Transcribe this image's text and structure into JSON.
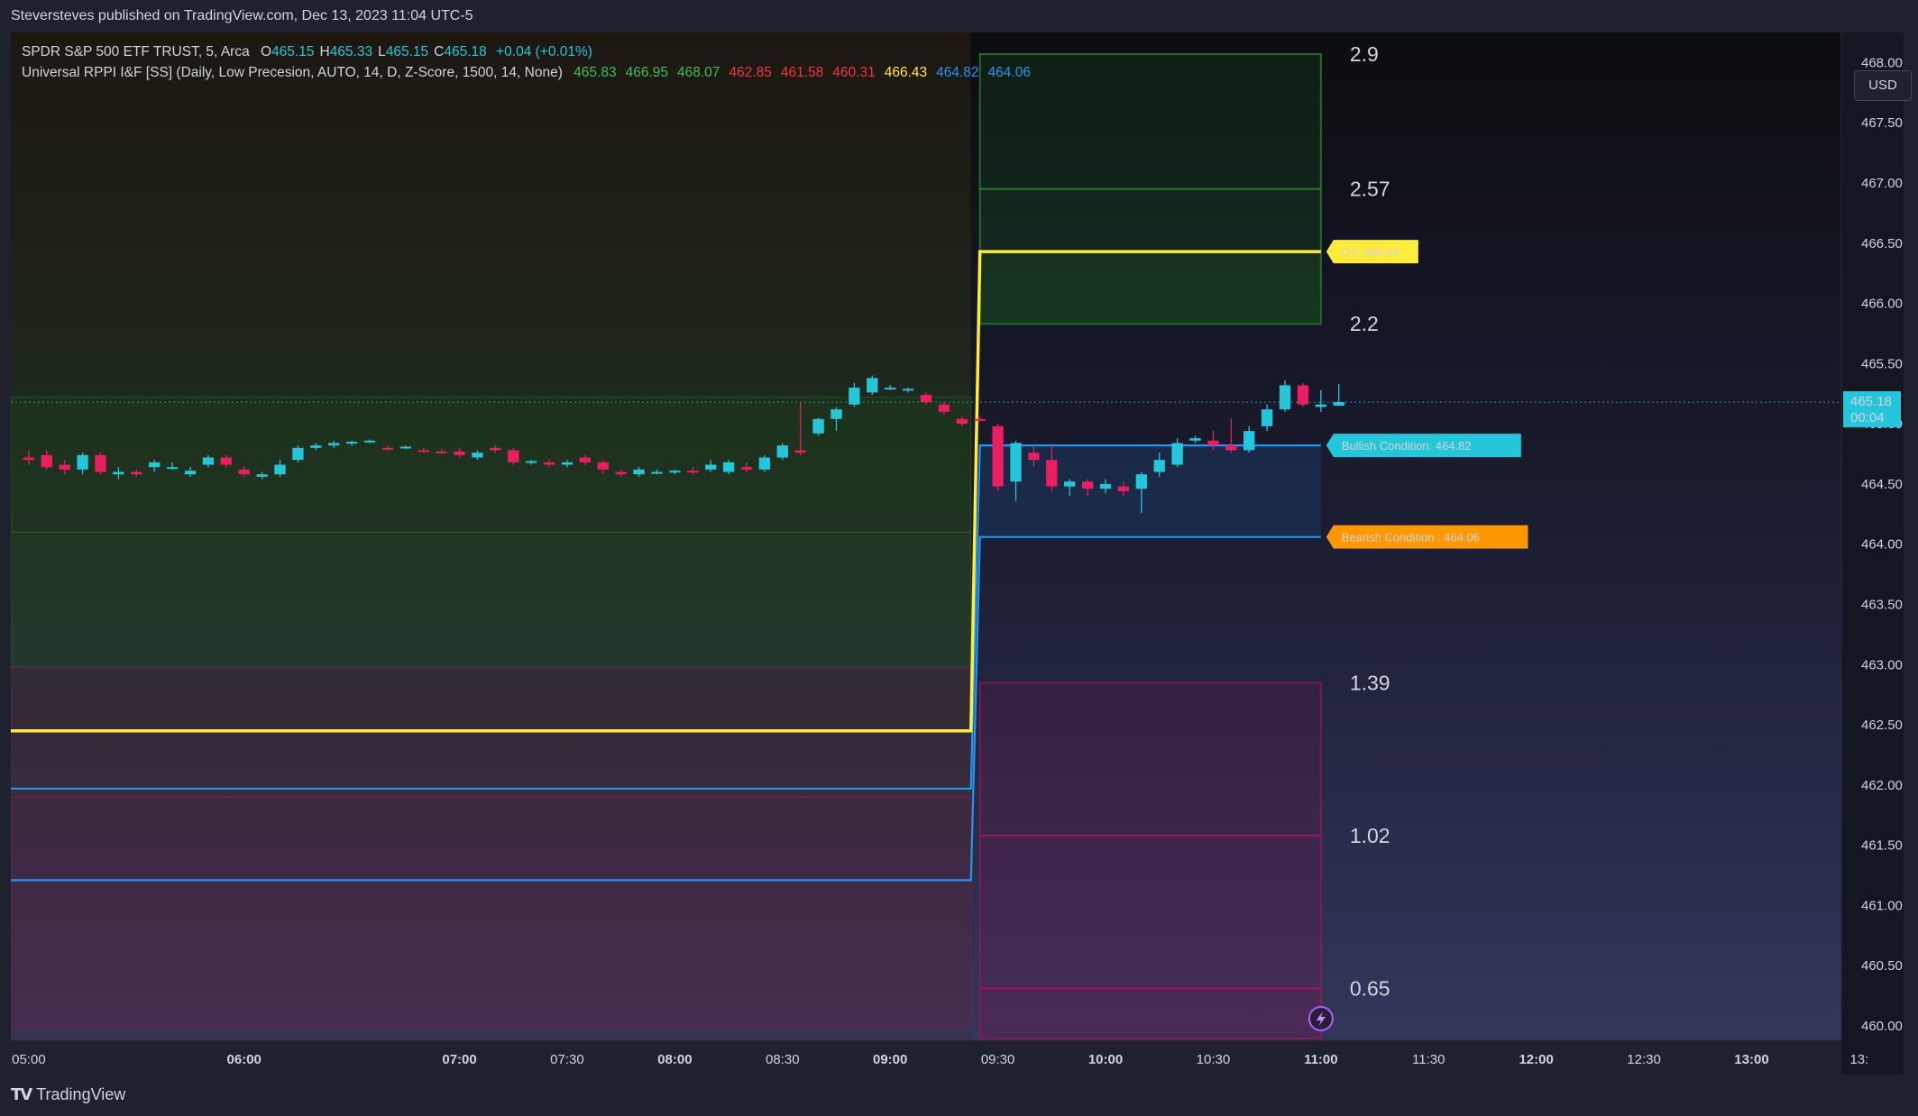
{
  "publish": {
    "text": "Steversteves published on TradingView.com, Dec 13, 2023 11:04 UTC-5"
  },
  "currency": "USD",
  "footer": {
    "brand": "TradingView"
  },
  "legend": {
    "symbol": "SPDR S&P 500 ETF TRUST, 5, Arca",
    "ohlc": [
      {
        "key": "O",
        "value": "465.15"
      },
      {
        "key": "H",
        "value": "465.33"
      },
      {
        "key": "L",
        "value": "465.15"
      },
      {
        "key": "C",
        "value": "465.18"
      }
    ],
    "change": "+0.04 (+0.01%)",
    "indicator": "Universal RPPI I&F [SS] (Daily, Low Precesion, AUTO, 14, D, Z-Score, 1500, 14, None)",
    "indicator_values": [
      {
        "text": "465.83",
        "color": "#3fbf5a"
      },
      {
        "text": "466.95",
        "color": "#3fbf5a"
      },
      {
        "text": "468.07",
        "color": "#3fbf5a"
      },
      {
        "text": "462.85",
        "color": "#f23645"
      },
      {
        "text": "461.58",
        "color": "#f23645"
      },
      {
        "text": "460.31",
        "color": "#f23645"
      },
      {
        "text": "466.43",
        "color": "#ffeb3b"
      },
      {
        "text": "464.82",
        "color": "#2196f3"
      },
      {
        "text": "464.06",
        "color": "#2196f3"
      }
    ]
  },
  "colors": {
    "up": "#26c6da",
    "down": "#e91e63",
    "gt": "#ffeb3b",
    "condition": "#2196f3",
    "bull_label": "#26c6da",
    "bear_label": "#ff9800",
    "zone_green": "#1b5e20",
    "zone_red": "#880e4f"
  },
  "chart_data": {
    "type": "candlestick",
    "title": "",
    "xlabel": "",
    "ylabel": "",
    "ylim": [
      459.88,
      468.25
    ],
    "xlim_minutes": [
      295,
      805
    ],
    "y_ticks": [
      "460.00",
      "460.50",
      "461.00",
      "461.50",
      "462.00",
      "462.50",
      "463.00",
      "463.50",
      "464.00",
      "464.50",
      "465.00",
      "465.50",
      "466.00",
      "466.50",
      "467.00",
      "467.50",
      "468.00"
    ],
    "x_ticks": [
      {
        "label": "05:00",
        "minute": 300,
        "bold": false
      },
      {
        "label": "06:00",
        "minute": 360,
        "bold": true
      },
      {
        "label": "07:00",
        "minute": 420,
        "bold": true
      },
      {
        "label": "07:30",
        "minute": 450,
        "bold": false
      },
      {
        "label": "08:00",
        "minute": 480,
        "bold": true
      },
      {
        "label": "08:30",
        "minute": 510,
        "bold": false
      },
      {
        "label": "09:00",
        "minute": 540,
        "bold": true
      },
      {
        "label": "09:30",
        "minute": 570,
        "bold": false
      },
      {
        "label": "10:00",
        "minute": 600,
        "bold": true
      },
      {
        "label": "10:30",
        "minute": 630,
        "bold": false
      },
      {
        "label": "11:00",
        "minute": 660,
        "bold": true
      },
      {
        "label": "11:30",
        "minute": 690,
        "bold": false
      },
      {
        "label": "12:00",
        "minute": 720,
        "bold": true
      },
      {
        "label": "12:30",
        "minute": 750,
        "bold": false
      },
      {
        "label": "13:00",
        "minute": 780,
        "bold": true
      },
      {
        "label": "13:",
        "minute": 810,
        "bold": false
      }
    ],
    "previous_session": {
      "end_minute": 562.5,
      "gt": 462.45,
      "bullish": 461.97,
      "bearish": 461.21,
      "zones": [
        {
          "from": 465.22,
          "to": 464.1,
          "color": "green"
        },
        {
          "from": 464.1,
          "to": 462.98,
          "color": "green"
        },
        {
          "from": 462.98,
          "to": 461.9,
          "color": "red"
        },
        {
          "from": 461.9,
          "to": 460.0,
          "color": "red"
        }
      ]
    },
    "current_session": {
      "start_minute": 565,
      "end_minute": 660,
      "gt": 466.43,
      "bullish": 464.82,
      "bearish": 464.06,
      "levels": [
        {
          "price": 468.07,
          "zscore": "2.9",
          "kind": "green"
        },
        {
          "price": 466.95,
          "zscore": "2.57",
          "kind": "green"
        },
        {
          "price": 465.83,
          "zscore": "2.2",
          "kind": "green"
        },
        {
          "price": 462.85,
          "zscore": "1.39",
          "kind": "red"
        },
        {
          "price": 461.58,
          "zscore": "1.02",
          "kind": "red"
        },
        {
          "price": 460.31,
          "zscore": "0.65",
          "kind": "red"
        }
      ]
    },
    "labels": [
      {
        "text": "GT: 466.43",
        "price": 466.43,
        "style": "gt"
      },
      {
        "text": "Bullish Condition: 464.82",
        "price": 464.82,
        "style": "bull"
      },
      {
        "text": "Bearish Condition : 464.06",
        "price": 464.06,
        "style": "bear"
      }
    ],
    "last_price": {
      "price": "465.18",
      "countdown": "00:04",
      "value": 465.18
    },
    "candles": [
      {
        "t": 300,
        "o": 464.72,
        "h": 464.78,
        "l": 464.66,
        "c": 464.7
      },
      {
        "t": 305,
        "o": 464.74,
        "h": 464.78,
        "l": 464.62,
        "c": 464.64
      },
      {
        "t": 310,
        "o": 464.66,
        "h": 464.7,
        "l": 464.58,
        "c": 464.62
      },
      {
        "t": 315,
        "o": 464.62,
        "h": 464.76,
        "l": 464.58,
        "c": 464.74
      },
      {
        "t": 320,
        "o": 464.74,
        "h": 464.76,
        "l": 464.58,
        "c": 464.6
      },
      {
        "t": 325,
        "o": 464.58,
        "h": 464.64,
        "l": 464.54,
        "c": 464.6
      },
      {
        "t": 330,
        "o": 464.6,
        "h": 464.62,
        "l": 464.56,
        "c": 464.58
      },
      {
        "t": 335,
        "o": 464.64,
        "h": 464.7,
        "l": 464.6,
        "c": 464.68
      },
      {
        "t": 340,
        "o": 464.64,
        "h": 464.68,
        "l": 464.62,
        "c": 464.64
      },
      {
        "t": 345,
        "o": 464.58,
        "h": 464.64,
        "l": 464.56,
        "c": 464.61
      },
      {
        "t": 350,
        "o": 464.66,
        "h": 464.74,
        "l": 464.64,
        "c": 464.72
      },
      {
        "t": 355,
        "o": 464.72,
        "h": 464.74,
        "l": 464.64,
        "c": 464.66
      },
      {
        "t": 360,
        "o": 464.62,
        "h": 464.64,
        "l": 464.56,
        "c": 464.58
      },
      {
        "t": 365,
        "o": 464.56,
        "h": 464.6,
        "l": 464.54,
        "c": 464.58
      },
      {
        "t": 370,
        "o": 464.58,
        "h": 464.7,
        "l": 464.56,
        "c": 464.66
      },
      {
        "t": 375,
        "o": 464.7,
        "h": 464.82,
        "l": 464.68,
        "c": 464.8
      },
      {
        "t": 380,
        "o": 464.8,
        "h": 464.84,
        "l": 464.78,
        "c": 464.82
      },
      {
        "t": 385,
        "o": 464.82,
        "h": 464.86,
        "l": 464.8,
        "c": 464.84
      },
      {
        "t": 390,
        "o": 464.84,
        "h": 464.86,
        "l": 464.82,
        "c": 464.85
      },
      {
        "t": 395,
        "o": 464.85,
        "h": 464.87,
        "l": 464.84,
        "c": 464.86
      },
      {
        "t": 400,
        "o": 464.8,
        "h": 464.82,
        "l": 464.78,
        "c": 464.79
      },
      {
        "t": 405,
        "o": 464.8,
        "h": 464.82,
        "l": 464.79,
        "c": 464.81
      },
      {
        "t": 410,
        "o": 464.78,
        "h": 464.8,
        "l": 464.76,
        "c": 464.77
      },
      {
        "t": 415,
        "o": 464.77,
        "h": 464.79,
        "l": 464.75,
        "c": 464.76
      },
      {
        "t": 420,
        "o": 464.77,
        "h": 464.8,
        "l": 464.72,
        "c": 464.74
      },
      {
        "t": 425,
        "o": 464.72,
        "h": 464.78,
        "l": 464.7,
        "c": 464.76
      },
      {
        "t": 430,
        "o": 464.8,
        "h": 464.82,
        "l": 464.76,
        "c": 464.78
      },
      {
        "t": 435,
        "o": 464.78,
        "h": 464.8,
        "l": 464.66,
        "c": 464.68
      },
      {
        "t": 440,
        "o": 464.68,
        "h": 464.7,
        "l": 464.66,
        "c": 464.69
      },
      {
        "t": 445,
        "o": 464.68,
        "h": 464.7,
        "l": 464.64,
        "c": 464.66
      },
      {
        "t": 450,
        "o": 464.66,
        "h": 464.7,
        "l": 464.64,
        "c": 464.68
      },
      {
        "t": 455,
        "o": 464.72,
        "h": 464.74,
        "l": 464.66,
        "c": 464.68
      },
      {
        "t": 460,
        "o": 464.68,
        "h": 464.7,
        "l": 464.58,
        "c": 464.62
      },
      {
        "t": 465,
        "o": 464.6,
        "h": 464.62,
        "l": 464.56,
        "c": 464.58
      },
      {
        "t": 470,
        "o": 464.58,
        "h": 464.64,
        "l": 464.56,
        "c": 464.62
      },
      {
        "t": 475,
        "o": 464.6,
        "h": 464.62,
        "l": 464.58,
        "c": 464.6
      },
      {
        "t": 480,
        "o": 464.6,
        "h": 464.62,
        "l": 464.58,
        "c": 464.61
      },
      {
        "t": 485,
        "o": 464.61,
        "h": 464.64,
        "l": 464.58,
        "c": 464.6
      },
      {
        "t": 490,
        "o": 464.62,
        "h": 464.7,
        "l": 464.6,
        "c": 464.66
      },
      {
        "t": 495,
        "o": 464.6,
        "h": 464.7,
        "l": 464.58,
        "c": 464.68
      },
      {
        "t": 500,
        "o": 464.64,
        "h": 464.68,
        "l": 464.6,
        "c": 464.62
      },
      {
        "t": 505,
        "o": 464.62,
        "h": 464.74,
        "l": 464.6,
        "c": 464.72
      },
      {
        "t": 510,
        "o": 464.72,
        "h": 464.84,
        "l": 464.7,
        "c": 464.82
      },
      {
        "t": 515,
        "o": 464.78,
        "h": 465.18,
        "l": 464.74,
        "c": 464.76
      },
      {
        "t": 520,
        "o": 464.92,
        "h": 465.05,
        "l": 464.9,
        "c": 465.04
      },
      {
        "t": 525,
        "o": 465.04,
        "h": 465.14,
        "l": 464.94,
        "c": 465.12
      },
      {
        "t": 530,
        "o": 465.16,
        "h": 465.34,
        "l": 465.14,
        "c": 465.3
      },
      {
        "t": 535,
        "o": 465.26,
        "h": 465.4,
        "l": 465.24,
        "c": 465.38
      },
      {
        "t": 540,
        "o": 465.3,
        "h": 465.32,
        "l": 465.28,
        "c": 465.3
      },
      {
        "t": 545,
        "o": 465.28,
        "h": 465.3,
        "l": 465.26,
        "c": 465.29
      },
      {
        "t": 550,
        "o": 465.24,
        "h": 465.26,
        "l": 465.16,
        "c": 465.18
      },
      {
        "t": 555,
        "o": 465.16,
        "h": 465.18,
        "l": 465.08,
        "c": 465.1
      },
      {
        "t": 560,
        "o": 465.04,
        "h": 465.06,
        "l": 464.98,
        "c": 465.0
      },
      {
        "t": 565,
        "o": 465.04,
        "h": 465.06,
        "l": 465.02,
        "c": 465.03
      },
      {
        "t": 570,
        "o": 464.98,
        "h": 465.0,
        "l": 464.44,
        "c": 464.48
      },
      {
        "t": 575,
        "o": 464.52,
        "h": 464.86,
        "l": 464.36,
        "c": 464.84
      },
      {
        "t": 580,
        "o": 464.76,
        "h": 464.82,
        "l": 464.64,
        "c": 464.7
      },
      {
        "t": 585,
        "o": 464.7,
        "h": 464.82,
        "l": 464.44,
        "c": 464.48
      },
      {
        "t": 590,
        "o": 464.48,
        "h": 464.54,
        "l": 464.4,
        "c": 464.52
      },
      {
        "t": 595,
        "o": 464.52,
        "h": 464.54,
        "l": 464.4,
        "c": 464.46
      },
      {
        "t": 600,
        "o": 464.46,
        "h": 464.54,
        "l": 464.42,
        "c": 464.5
      },
      {
        "t": 605,
        "o": 464.48,
        "h": 464.52,
        "l": 464.4,
        "c": 464.44
      },
      {
        "t": 610,
        "o": 464.46,
        "h": 464.6,
        "l": 464.26,
        "c": 464.58
      },
      {
        "t": 615,
        "o": 464.6,
        "h": 464.76,
        "l": 464.56,
        "c": 464.7
      },
      {
        "t": 620,
        "o": 464.66,
        "h": 464.88,
        "l": 464.64,
        "c": 464.84
      },
      {
        "t": 625,
        "o": 464.86,
        "h": 464.9,
        "l": 464.84,
        "c": 464.88
      },
      {
        "t": 630,
        "o": 464.86,
        "h": 464.94,
        "l": 464.78,
        "c": 464.82
      },
      {
        "t": 635,
        "o": 464.82,
        "h": 465.04,
        "l": 464.76,
        "c": 464.78
      },
      {
        "t": 640,
        "o": 464.78,
        "h": 464.98,
        "l": 464.76,
        "c": 464.94
      },
      {
        "t": 645,
        "o": 464.98,
        "h": 465.16,
        "l": 464.94,
        "c": 465.12
      },
      {
        "t": 650,
        "o": 465.12,
        "h": 465.36,
        "l": 465.1,
        "c": 465.32
      },
      {
        "t": 655,
        "o": 465.32,
        "h": 465.34,
        "l": 465.14,
        "c": 465.16
      },
      {
        "t": 660,
        "o": 465.14,
        "h": 465.28,
        "l": 465.1,
        "c": 465.16
      },
      {
        "t": 665,
        "o": 465.15,
        "h": 465.33,
        "l": 465.15,
        "c": 465.18
      }
    ]
  }
}
